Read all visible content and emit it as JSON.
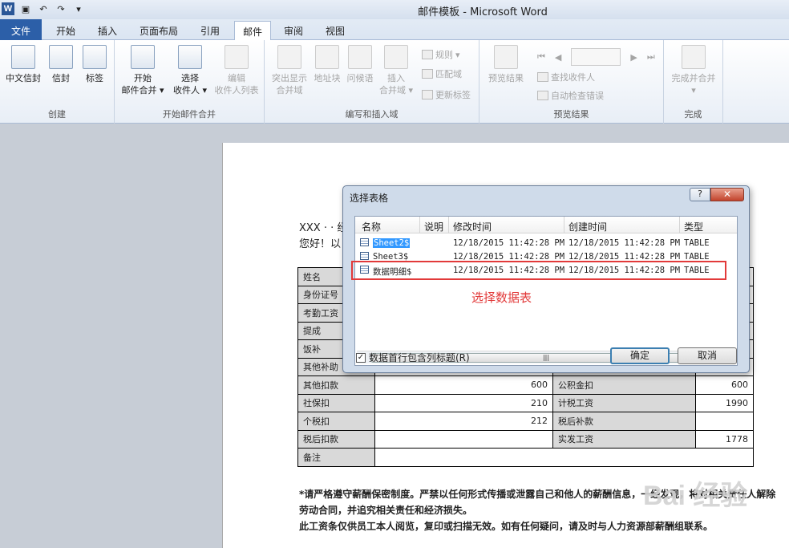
{
  "window": {
    "title": "邮件模板 - Microsoft Word"
  },
  "tabs": [
    "文件",
    "开始",
    "插入",
    "页面布局",
    "引用",
    "邮件",
    "审阅",
    "视图"
  ],
  "ribbon": {
    "create": {
      "label": "创建",
      "buttons": [
        "中文信封",
        "信封",
        "标签"
      ]
    },
    "start_merge": {
      "label": "开始邮件合并",
      "start": [
        "开始",
        "邮件合并"
      ],
      "select": [
        "选择",
        "收件人"
      ],
      "edit": [
        "编辑",
        "收件人列表"
      ]
    },
    "write_insert": {
      "label": "编写和插入域",
      "highlight": [
        "突出显示",
        "合并域"
      ],
      "address": "地址块",
      "greeting": "问候语",
      "insert": [
        "插入",
        "合并域"
      ],
      "rules": "规则",
      "match": "匹配域",
      "update": "更新标签"
    },
    "preview": {
      "label": "预览结果",
      "preview_btn": "预览结果",
      "find": "查找收件人",
      "auto": "自动检查错误"
    },
    "finish": {
      "label": "完成",
      "finish_btn": "完成并合并"
    }
  },
  "document": {
    "line1": "XXX · · 经",
    "line2": "您好！以",
    "table": [
      [
        "姓名",
        "",
        "",
        ""
      ],
      [
        "身份证号",
        "",
        "",
        ""
      ],
      [
        "考勤工资",
        "",
        "",
        ""
      ],
      [
        "提成",
        "",
        "",
        ""
      ],
      [
        "饭补",
        "",
        "",
        ""
      ],
      [
        "其他补助",
        "",
        "",
        ""
      ],
      [
        "其他扣款",
        "600",
        "公积金扣",
        "600"
      ],
      [
        "社保扣",
        "210",
        "计税工资",
        "1990"
      ],
      [
        "个税扣",
        "212",
        "税后补款",
        ""
      ],
      [
        "税后扣款",
        "",
        "实发工资",
        "1778"
      ],
      [
        "备注",
        "",
        "",
        ""
      ]
    ],
    "note1": "*请严格遵守薪酬保密制度。严禁以任何形式传播或泄露自己和他人的薪酬信息，一经发现，将对相关责任人解除劳动合同，并追究相关责任和经济损失。",
    "note2": "此工资条仅供员工本人阅览，复印或扫描无效。如有任何疑问，请及时与人力资源部薪酬组联系。"
  },
  "dialog": {
    "title": "选择表格",
    "help": "?",
    "close": "✕",
    "columns": [
      "名称",
      "说明",
      "修改时间",
      "创建时间",
      "类型"
    ],
    "rows": [
      {
        "name": "Sheet2$",
        "desc": "",
        "modified": "12/18/2015 11:42:28 PM",
        "created": "12/18/2015 11:42:28 PM",
        "type": "TABLE"
      },
      {
        "name": "Sheet3$",
        "desc": "",
        "modified": "12/18/2015 11:42:28 PM",
        "created": "12/18/2015 11:42:28 PM",
        "type": "TABLE"
      },
      {
        "name": "数据明细$",
        "desc": "",
        "modified": "12/18/2015 11:42:28 PM",
        "created": "12/18/2015 11:42:28 PM",
        "type": "TABLE"
      }
    ],
    "annotation": "选择数据表",
    "checkbox_label": "数据首行包含列标题(R)",
    "checkbox_checked": true,
    "ok": "确定",
    "cancel": "取消"
  },
  "watermark": "Bai 经验",
  "colors": {
    "accent": "#2c5fa8",
    "annotation": "#e23a3a"
  }
}
